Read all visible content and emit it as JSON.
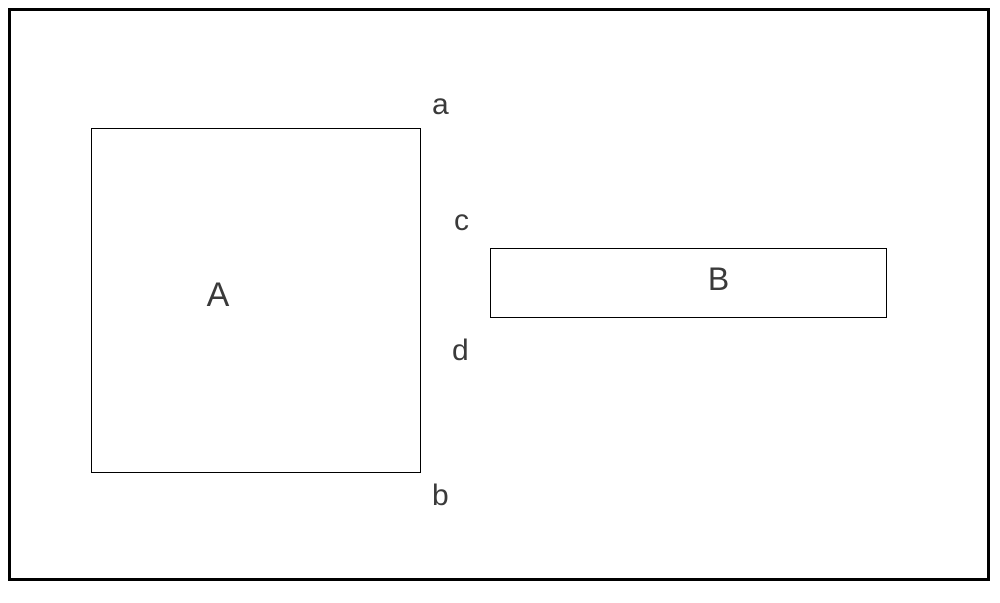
{
  "shapes": {
    "a": {
      "label": "A"
    },
    "b": {
      "label": "B"
    }
  },
  "corner_labels": {
    "a": "a",
    "b": "b",
    "c": "c",
    "d": "d"
  }
}
